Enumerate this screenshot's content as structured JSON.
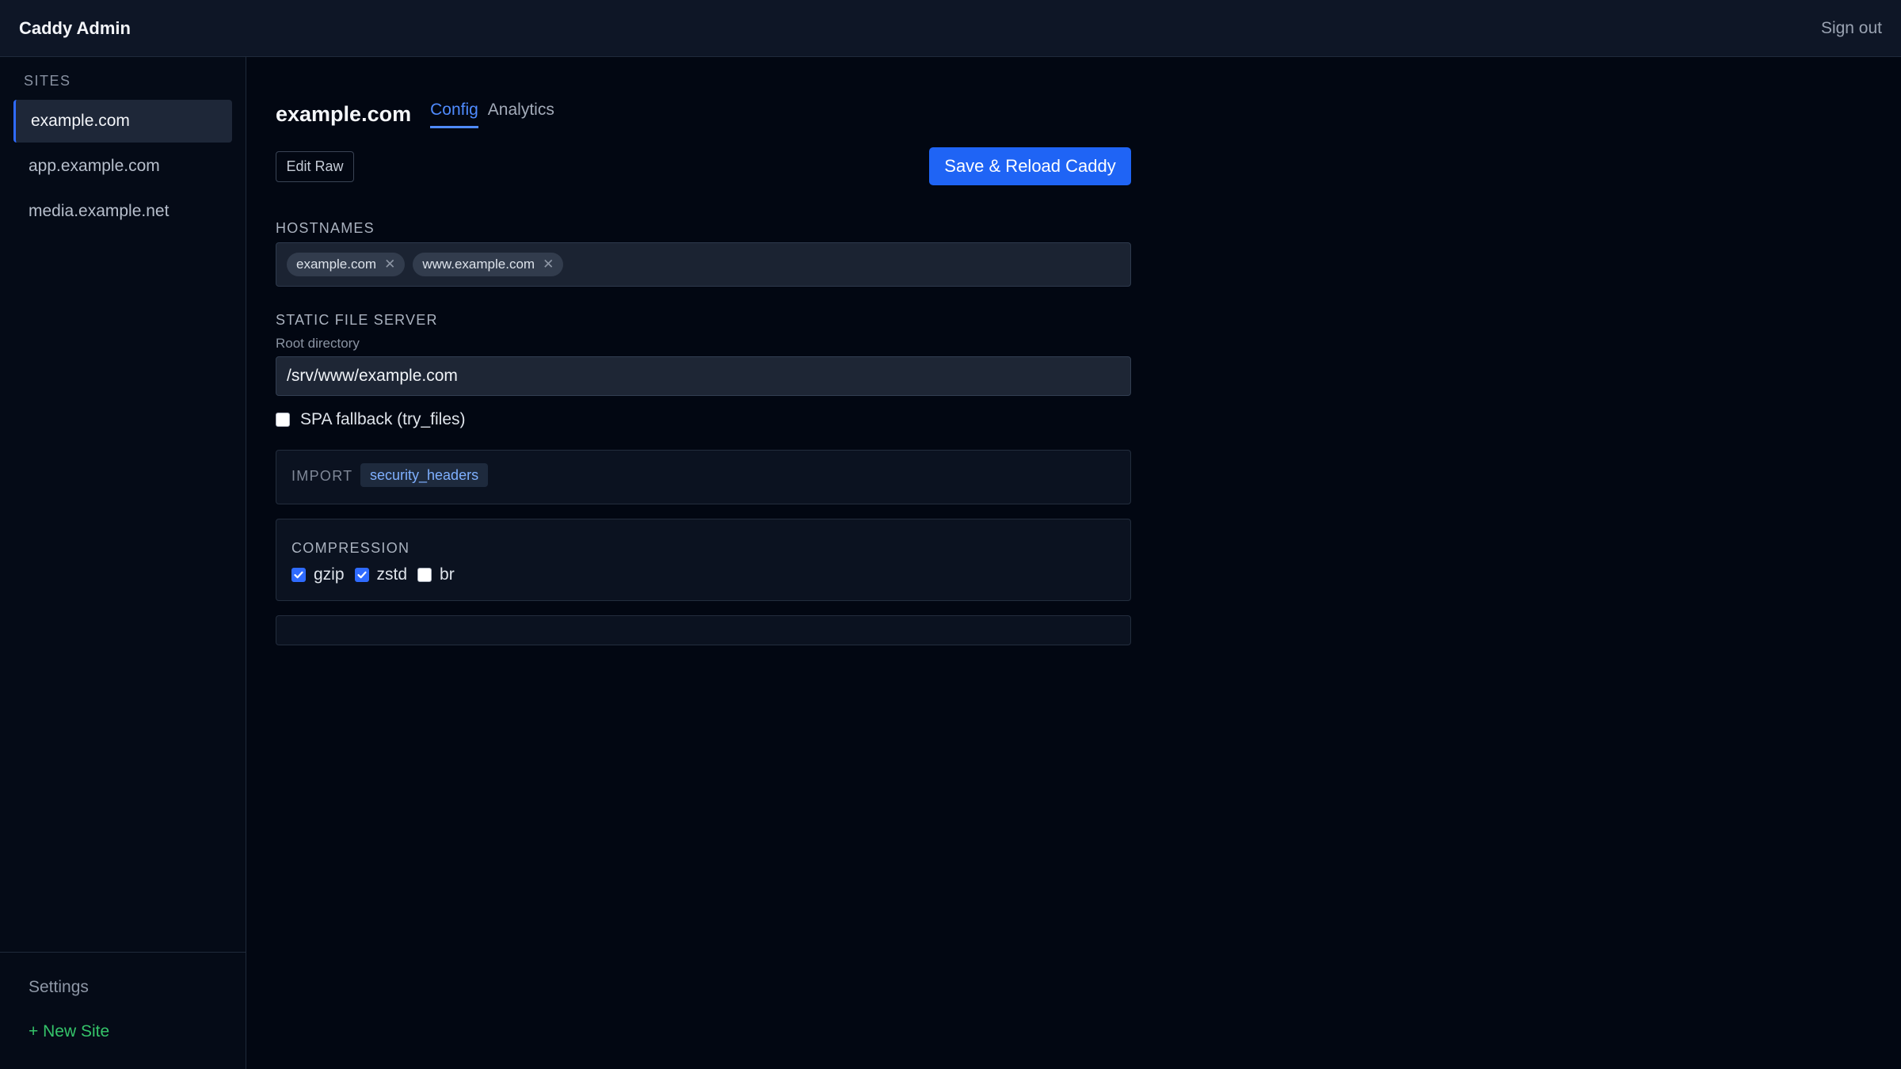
{
  "app": {
    "title": "Caddy Admin",
    "sign_out": "Sign out"
  },
  "sidebar": {
    "heading": "SITES",
    "items": [
      {
        "label": "example.com",
        "active": true
      },
      {
        "label": "app.example.com",
        "active": false
      },
      {
        "label": "media.example.net",
        "active": false
      }
    ],
    "settings": "Settings",
    "new_site": "+ New Site"
  },
  "main": {
    "site_title": "example.com",
    "tabs": [
      {
        "label": "Config",
        "active": true
      },
      {
        "label": "Analytics",
        "active": false
      }
    ],
    "edit_raw": "Edit Raw",
    "save_reload": "Save & Reload Caddy",
    "hostnames": {
      "label": "HOSTNAMES",
      "chips": [
        "example.com",
        "www.example.com"
      ]
    },
    "static_file_server": {
      "label": "STATIC FILE SERVER",
      "root_label": "Root directory",
      "root_value": "/srv/www/example.com",
      "spa_fallback_label": "SPA fallback (try_files)",
      "spa_fallback_checked": false
    },
    "import": {
      "label": "IMPORT",
      "snippet": "security_headers"
    },
    "compression": {
      "label": "COMPRESSION",
      "options": [
        {
          "label": "gzip",
          "checked": true
        },
        {
          "label": "zstd",
          "checked": true
        },
        {
          "label": "br",
          "checked": false
        }
      ]
    }
  },
  "colors": {
    "accent": "#1f64f5",
    "tab_active": "#4f8bff",
    "new_site": "#35c46a",
    "background": "#020712"
  }
}
